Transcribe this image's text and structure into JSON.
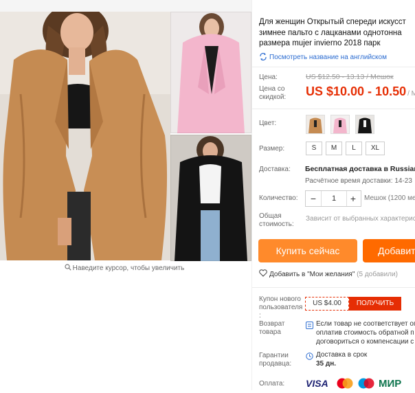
{
  "gallery": {
    "zoom_hint": "Наведите курсор, чтобы увеличить"
  },
  "product": {
    "title": "Для женщин Открытый спереди искусст зимнее пальто с лацканами однотонна размера mujer invierno 2018 парк",
    "translate_link": "Посмотреть название на английском"
  },
  "price": {
    "label": "Цена:",
    "old_price": "US $12.50 - 13.13 / Мешок",
    "discount_label": "Цена со скидкой:",
    "new_price": "US $10.00 - 10.50",
    "unit": "/ М"
  },
  "color": {
    "label": "Цвет:",
    "swatches": [
      "brown-coat",
      "pink-coat",
      "black-coat"
    ]
  },
  "size": {
    "label": "Размер:",
    "options": [
      "S",
      "M",
      "L",
      "XL"
    ]
  },
  "shipping": {
    "label": "Доставка:",
    "main": "Бесплатная доставка в Russian Fe",
    "time": "Расчётное время доставки: 14-23"
  },
  "quantity": {
    "label": "Количество:",
    "minus": "−",
    "value": "1",
    "plus": "+",
    "note": "Мешок (1200 ме"
  },
  "total": {
    "label": "Общая стоимость:",
    "note": "Зависит от выбранных характерис"
  },
  "actions": {
    "buy_now": "Купить сейчас",
    "add_to_cart": "Добавит"
  },
  "wishlist": {
    "label": "Добавить в \"Мои желания\"",
    "count": "(5 добавили)"
  },
  "coupon": {
    "label": "Купон нового пользователя :",
    "value": "US $4.00",
    "get": "ПОЛУЧИТЬ"
  },
  "returns": {
    "label": "Возврат товара",
    "line1": "Если товар не соответствует оп",
    "line2": "оплатив стоимость обратной п",
    "line3": "договориться о компенсации с"
  },
  "guarantee": {
    "label": "Гарантии продавца:",
    "line1": "Доставка в срок",
    "line2": "35 дн."
  },
  "payment": {
    "label": "Оплата:",
    "methods": [
      "VISA",
      "MasterCard",
      "Maestro",
      "МИР"
    ]
  },
  "colors": {
    "accent": "#e62e04",
    "buy_now": "#ff8a2b",
    "add_cart": "#ff6a00",
    "link": "#2a6bd0"
  }
}
